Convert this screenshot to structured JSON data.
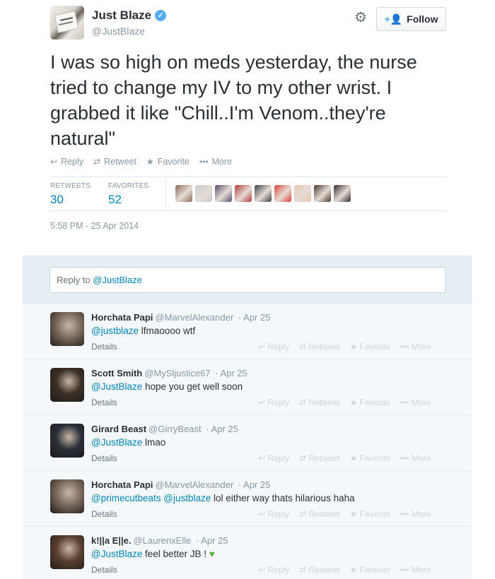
{
  "tweet": {
    "name": "Just Blaze",
    "handle": "@JustBlaze",
    "text": "I was so high on meds yesterday, the nurse tried to change my IV to my other wrist. I grabbed it like \"Chill..I'm Venom..they're natural\"",
    "follow_label": "Follow",
    "actions": {
      "reply": "Reply",
      "retweet": "Retweet",
      "favorite": "Favorite",
      "more": "More"
    },
    "stats": {
      "retweets_label": "RETWEETS",
      "retweets": "30",
      "favorites_label": "FAVORITES",
      "favorites": "52"
    },
    "timestamp": "5:58 PM - 25 Apr 2014",
    "favoriter_avatars": [
      {
        "color": "#8a6a5a"
      },
      {
        "color": "#c9ccd0"
      },
      {
        "color": "#5a4d6e"
      },
      {
        "color": "#b23a3a"
      },
      {
        "color": "#3a3f45"
      },
      {
        "color": "#d9443a"
      },
      {
        "color": "#e8c8b8"
      },
      {
        "color": "#4a3530"
      },
      {
        "color": "#2f2a30"
      }
    ]
  },
  "reply_box": {
    "prefix": "Reply to ",
    "mention": "@JustBlaze"
  },
  "replies": [
    {
      "name": "Horchata Papi",
      "handle": "@MarvelAlexander",
      "date": "· Apr 25",
      "mention": "@justblaze",
      "text": " lfmaoooo wtf",
      "details": "Details",
      "avatar_color": "#7a6a5e"
    },
    {
      "name": "Scott Smith",
      "handle": "@MySljustice67",
      "date": "· Apr 25",
      "mention": "@JustBlaze",
      "text": " hope you get well soon",
      "details": "Details",
      "avatar_color": "#3b3026"
    },
    {
      "name": "Girard Beast",
      "handle": "@GirryBeast",
      "date": "· Apr 25",
      "mention": "@JustBlaze",
      "text": " lmao",
      "details": "Details",
      "avatar_color": "#2a2f38"
    },
    {
      "name": "Horchata Papi",
      "handle": "@MarvelAlexander",
      "date": "· Apr 25",
      "mention": "@primecutbeats @justblaze",
      "text": " lol either way thats hilarious haha",
      "details": "Details",
      "avatar_color": "#7a6a5e"
    },
    {
      "name": "k!||a E||e.",
      "handle": "@LaurenxElle",
      "date": "· Apr 25",
      "mention": "@JustBlaze",
      "text": " feel better JB ! ",
      "details": "Details",
      "avatar_color": "#5a4030",
      "emoji": "♥"
    }
  ],
  "reply_actions": {
    "reply": "Reply",
    "retweet": "Retweet",
    "favorite": "Favorite",
    "more": "More"
  }
}
